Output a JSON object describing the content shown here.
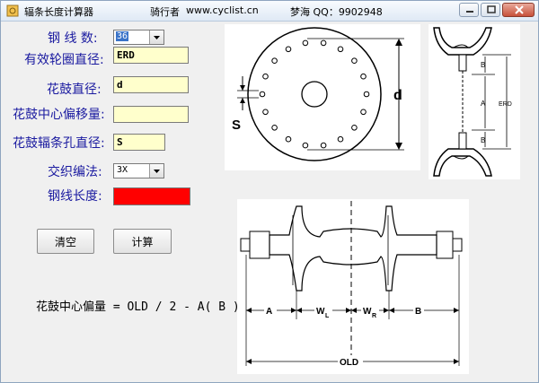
{
  "window": {
    "title": "辐条长度计算器",
    "author": "骑行者",
    "site": "www.cyclist.cn",
    "contact": "梦海  QQ：9902948"
  },
  "form": {
    "spoke_count": {
      "label": "钢 线 数:",
      "value": "36"
    },
    "erd": {
      "label": "有效轮圈直径:",
      "value": "ERD"
    },
    "hub_diameter": {
      "label": "花鼓直径:",
      "value": "d"
    },
    "hub_offset": {
      "label": "花鼓中心偏移量:",
      "value": ""
    },
    "spoke_hole": {
      "label": "花鼓辐条孔直径:",
      "value": "S"
    },
    "lacing": {
      "label": "交织编法:",
      "value": "3X"
    },
    "result": {
      "label": "钢线长度:"
    }
  },
  "buttons": {
    "clear": "清空",
    "calculate": "计算"
  },
  "formula": "花鼓中心偏量 = OLD / 2 - A( B )",
  "diagram_hub_flange": {
    "label_s": "S",
    "label_d": "d"
  },
  "diagram_rim": {
    "label_b": "B",
    "label_a": "A",
    "label_erd": "ERD"
  },
  "diagram_hub_side": {
    "label_a": "A",
    "label_wl": "W",
    "label_wl_sub": "L",
    "label_wr": "W",
    "label_wr_sub": "R",
    "label_b": "B",
    "label_old": "OLD"
  },
  "colors": {
    "label_text": "#1a1aa0",
    "input_bg": "#ffffcc",
    "result_bg": "#ff0000"
  }
}
